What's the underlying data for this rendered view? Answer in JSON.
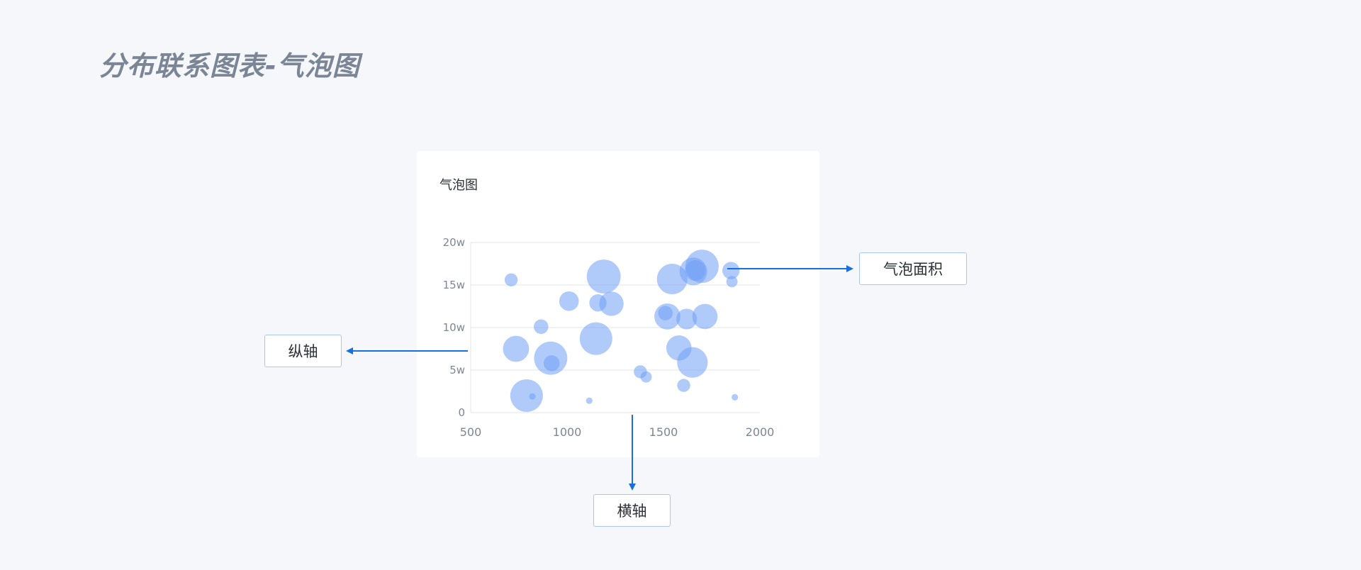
{
  "page": {
    "title": "分布联系图表-气泡图"
  },
  "card": {
    "title": "气泡图"
  },
  "callouts": {
    "bubble_area": "气泡面积",
    "y_axis": "纵轴",
    "x_axis": "横轴"
  },
  "colors": {
    "bubble": "#6f9ef5",
    "arrow": "#1a6fe0",
    "callout_border": "#a9c6f3",
    "grid": "#e6e9ee",
    "tick_text": "#7d8694"
  },
  "chart_data": {
    "type": "scatter",
    "title": "气泡图",
    "xlabel": "",
    "ylabel": "",
    "xlim": [
      500,
      2000
    ],
    "ylim": [
      0,
      200000
    ],
    "x_ticks": [
      500,
      1000,
      1500,
      2000
    ],
    "x_tick_labels": [
      "500",
      "1000",
      "1500",
      "2000"
    ],
    "y_ticks": [
      0,
      50000,
      100000,
      150000,
      200000
    ],
    "y_tick_labels": [
      "0",
      "5w",
      "10w",
      "15w",
      "20w"
    ],
    "grid": "horizontal",
    "points": [
      {
        "x": 710,
        "y": 156000,
        "size": 4
      },
      {
        "x": 735,
        "y": 75000,
        "size": 16
      },
      {
        "x": 790,
        "y": 20000,
        "size": 25
      },
      {
        "x": 820,
        "y": 19000,
        "size": 1
      },
      {
        "x": 865,
        "y": 101000,
        "size": 5
      },
      {
        "x": 915,
        "y": 64000,
        "size": 26
      },
      {
        "x": 920,
        "y": 58000,
        "size": 6
      },
      {
        "x": 1010,
        "y": 131000,
        "size": 9
      },
      {
        "x": 1115,
        "y": 14000,
        "size": 1
      },
      {
        "x": 1150,
        "y": 87000,
        "size": 25
      },
      {
        "x": 1160,
        "y": 129000,
        "size": 7
      },
      {
        "x": 1190,
        "y": 160000,
        "size": 27
      },
      {
        "x": 1230,
        "y": 128000,
        "size": 14
      },
      {
        "x": 1380,
        "y": 48000,
        "size": 4
      },
      {
        "x": 1410,
        "y": 42000,
        "size": 3
      },
      {
        "x": 1510,
        "y": 117000,
        "size": 5
      },
      {
        "x": 1520,
        "y": 113000,
        "size": 16
      },
      {
        "x": 1545,
        "y": 157000,
        "size": 22
      },
      {
        "x": 1580,
        "y": 76000,
        "size": 15
      },
      {
        "x": 1605,
        "y": 32000,
        "size": 4
      },
      {
        "x": 1620,
        "y": 110000,
        "size": 10
      },
      {
        "x": 1650,
        "y": 59000,
        "size": 22
      },
      {
        "x": 1655,
        "y": 166000,
        "size": 18
      },
      {
        "x": 1665,
        "y": 167000,
        "size": 10
      },
      {
        "x": 1700,
        "y": 172000,
        "size": 26
      },
      {
        "x": 1715,
        "y": 113000,
        "size": 15
      },
      {
        "x": 1850,
        "y": 167000,
        "size": 7
      },
      {
        "x": 1855,
        "y": 154000,
        "size": 3
      },
      {
        "x": 1870,
        "y": 18000,
        "size": 1
      }
    ]
  }
}
